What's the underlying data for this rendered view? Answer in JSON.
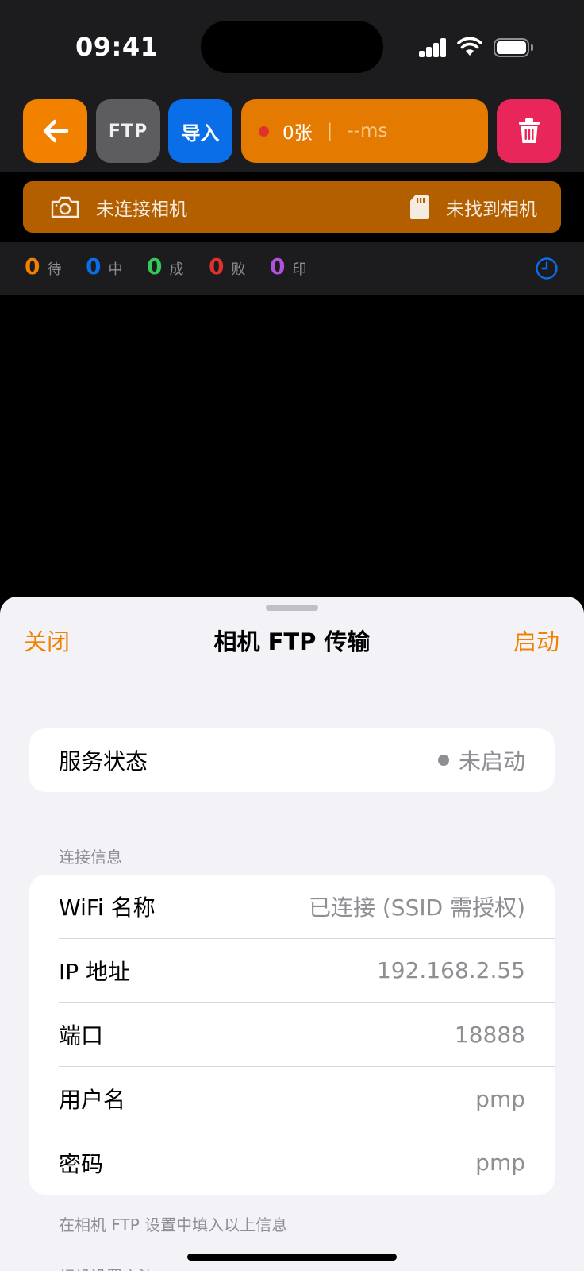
{
  "status_bar": {
    "time": "09:41"
  },
  "toolbar": {
    "back_icon": "arrow-left-icon",
    "ftp_label": "FTP",
    "import_label": "导入",
    "count_text": "0张",
    "separator": "|",
    "latency_text": "--ms",
    "trash_icon": "trash-icon",
    "colors": {
      "orange": "#f28100",
      "blue": "#0a6ee8",
      "red": "#e8265a",
      "gray": "#5d5d60"
    }
  },
  "camera_bar": {
    "left_icon": "camera-icon",
    "left_text": "未连接相机",
    "right_icon": "sd-card-icon",
    "right_text": "未找到相机"
  },
  "stats": [
    {
      "value": "0",
      "label": "待",
      "color": "#f28100"
    },
    {
      "value": "0",
      "label": "中",
      "color": "#0a6ee8"
    },
    {
      "value": "0",
      "label": "成",
      "color": "#34c759"
    },
    {
      "value": "0",
      "label": "败",
      "color": "#e0312c"
    },
    {
      "value": "0",
      "label": "印",
      "color": "#af52de"
    }
  ],
  "stats_history_icon": "clock-icon",
  "sheet": {
    "close_label": "关闭",
    "title": "相机 FTP 传输",
    "start_label": "启动",
    "service": {
      "key": "服务状态",
      "value": "未启动"
    },
    "connection_header": "连接信息",
    "connection": [
      {
        "key": "WiFi 名称",
        "value": "已连接 (SSID 需授权)"
      },
      {
        "key": "IP 地址",
        "value": "192.168.2.55"
      },
      {
        "key": "端口",
        "value": "18888"
      },
      {
        "key": "用户名",
        "value": "pmp"
      },
      {
        "key": "密码",
        "value": "pmp"
      }
    ],
    "footer_note": "在相机 FTP 设置中填入以上信息",
    "next_header": "相机设置方法"
  }
}
